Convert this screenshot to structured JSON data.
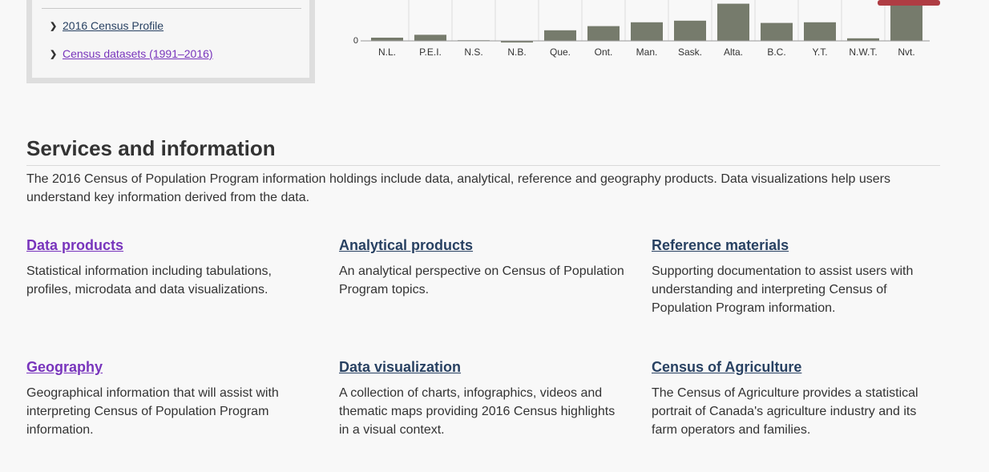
{
  "sidebar": {
    "links": [
      {
        "label": "2016 Census Profile",
        "visited": false
      },
      {
        "label": "Census datasets (1991–2016)",
        "visited": true
      }
    ]
  },
  "chart_data": {
    "type": "bar",
    "categories": [
      "N.L.",
      "P.E.I.",
      "N.S.",
      "N.B.",
      "Que.",
      "Ont.",
      "Man.",
      "Sask.",
      "Alta.",
      "B.C.",
      "Y.T.",
      "N.W.T.",
      "Nvt."
    ],
    "values": [
      1.0,
      1.9,
      0.2,
      -0.5,
      3.3,
      4.6,
      5.8,
      6.3,
      11.6,
      5.6,
      5.8,
      0.8,
      12.7
    ],
    "ytick_zero_label": "0",
    "colors": {
      "bar": "#767b6c",
      "axis": "#999999",
      "grid": "#dddddd",
      "highlight": "#af3c43"
    }
  },
  "services": {
    "title": "Services and information",
    "intro": "The 2016 Census of Population Program information holdings include data, analytical, reference and geography products. Data visualizations help users understand key information derived from the data.",
    "cards": [
      {
        "title": "Data products",
        "text": "Statistical information including tabulations, profiles, microdata and data visualizations.",
        "visited": true
      },
      {
        "title": "Analytical products",
        "text": "An analytical perspective on Census of Population Program topics.",
        "visited": false
      },
      {
        "title": "Reference materials",
        "text": "Supporting documentation to assist users with understanding and interpreting Census of Population Program information.",
        "visited": false
      },
      {
        "title": "Geography",
        "text": "Geographical information that will assist with interpreting Census of Population Program information.",
        "visited": true
      },
      {
        "title": "Data visualization",
        "text": "A collection of charts, infographics, videos and thematic maps providing 2016 Census highlights in a visual context.",
        "visited": false
      },
      {
        "title": "Census of Agriculture",
        "text": "The Census of Agriculture provides a statistical portrait of Canada's agriculture industry and its farm operators and families.",
        "visited": false
      }
    ]
  }
}
